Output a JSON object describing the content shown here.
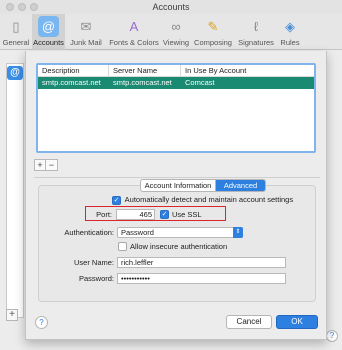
{
  "window": {
    "title": "Accounts"
  },
  "toolbar": {
    "items": [
      {
        "label": "General",
        "icon": "general-icon"
      },
      {
        "label": "Accounts",
        "icon": "at-sign-icon",
        "active": true
      },
      {
        "label": "Junk Mail",
        "icon": "junk-mail-icon"
      },
      {
        "label": "Fonts & Colors",
        "icon": "fonts-colors-icon"
      },
      {
        "label": "Viewing",
        "icon": "glasses-icon"
      },
      {
        "label": "Composing",
        "icon": "pencil-icon"
      },
      {
        "label": "Signatures",
        "icon": "signature-icon"
      },
      {
        "label": "Rules",
        "icon": "rules-icon"
      }
    ]
  },
  "server_table": {
    "columns": [
      "Description",
      "Server Name",
      "In Use By Account"
    ],
    "rows": [
      {
        "description": "smtp.comcast.net",
        "server_name": "smtp.comcast.net",
        "in_use_by": "Comcast",
        "selected": true
      }
    ]
  },
  "list_controls": {
    "add": "+",
    "remove": "−"
  },
  "tabs": {
    "account_information": "Account Information",
    "advanced": "Advanced",
    "selected": "Advanced"
  },
  "advanced": {
    "auto_detect_label": "Automatically detect and maintain account settings",
    "auto_detect_checked": true,
    "port_label": "Port:",
    "port_value": "465",
    "use_ssl_label": "Use SSL",
    "use_ssl_checked": true,
    "authentication_label": "Authentication:",
    "authentication_value": "Password",
    "allow_insecure_label": "Allow insecure authentication",
    "allow_insecure_checked": false,
    "user_name_label": "User Name:",
    "user_name_value": "rich.leffler",
    "password_label": "Password:",
    "password_value": "•••••••••••"
  },
  "buttons": {
    "help": "?",
    "cancel": "Cancel",
    "ok": "OK"
  },
  "colors": {
    "accent": "#2d7fe0",
    "selection": "#1a8a72",
    "highlight_border": "#d8262c"
  }
}
